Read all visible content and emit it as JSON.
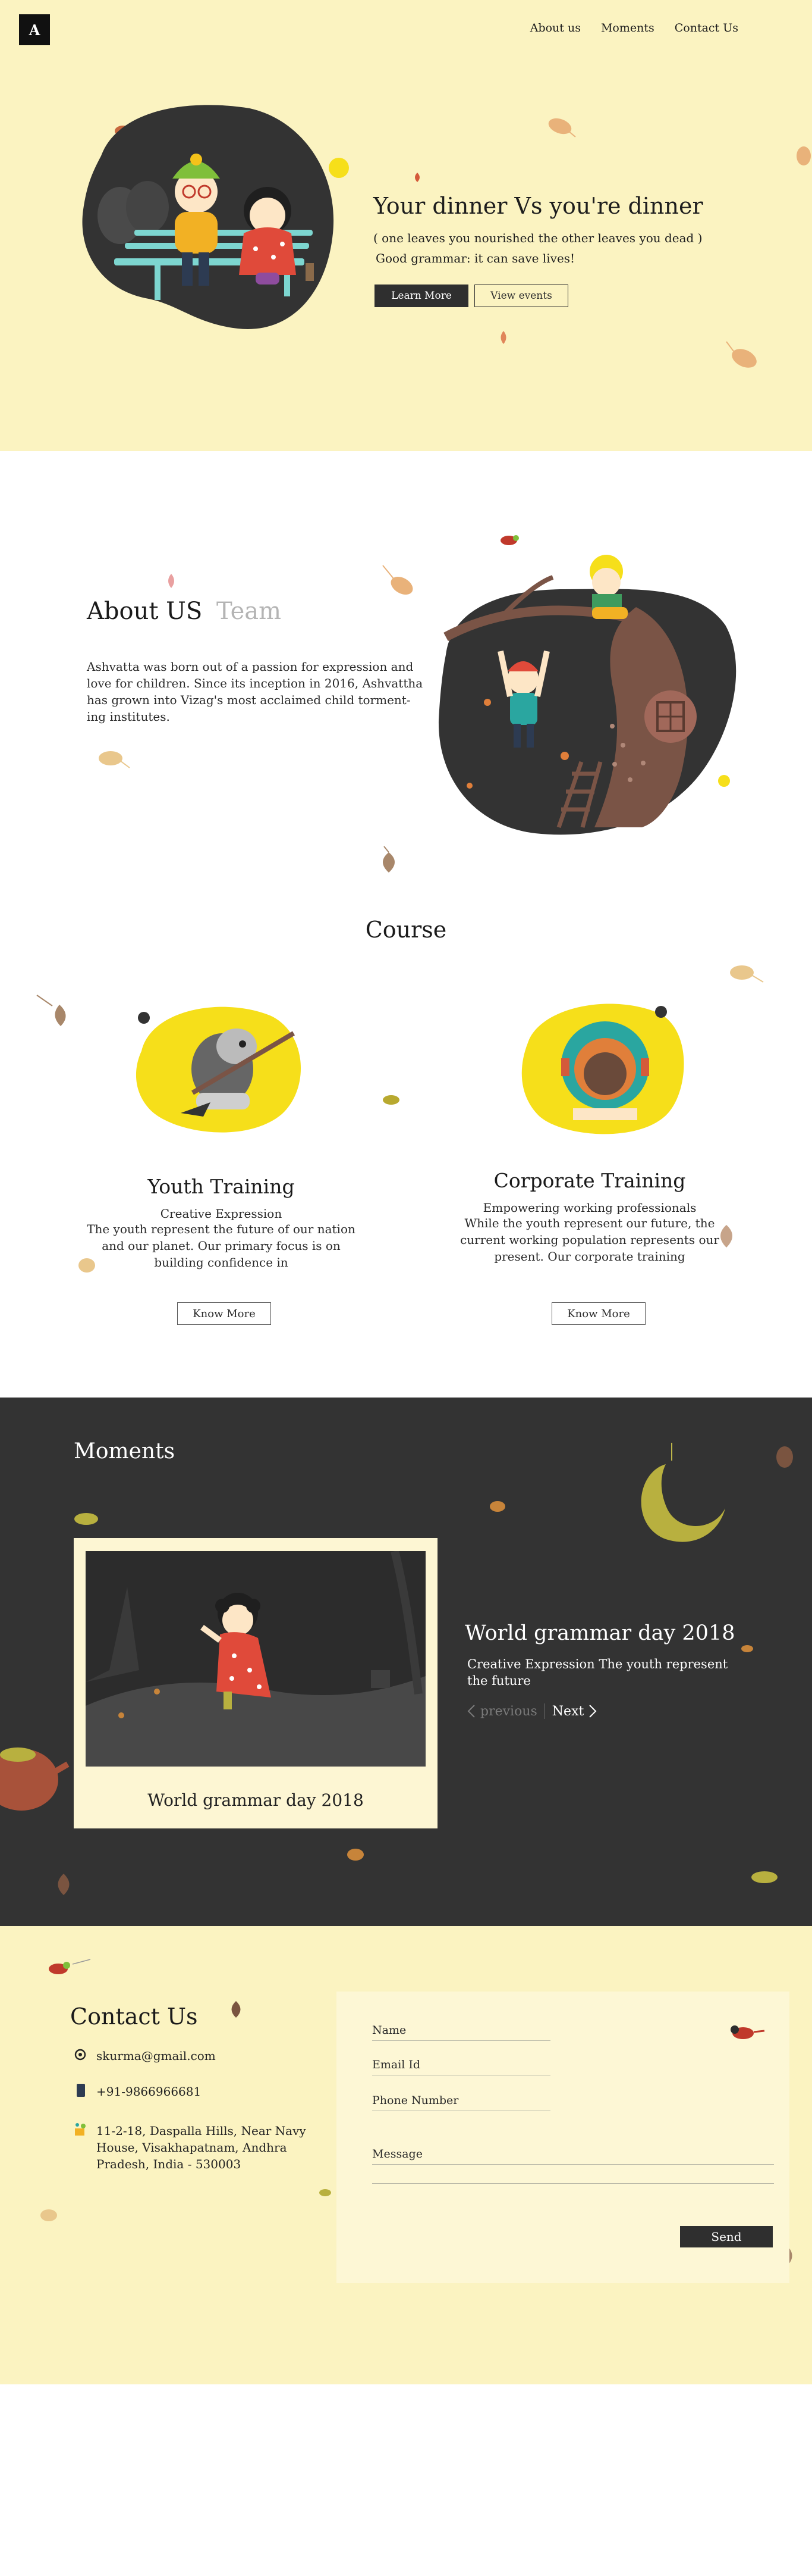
{
  "brand": {
    "logo_letter": "A"
  },
  "nav": {
    "items": [
      "About us",
      "Moments",
      "Contact Us"
    ]
  },
  "hero": {
    "title": "Your dinner Vs you're dinner",
    "sub1": "( one leaves you nourished the other leaves you dead )",
    "sub2": "Good grammar: it can save lives!",
    "btn_primary": "Learn More",
    "btn_secondary": "View events"
  },
  "about": {
    "heading": "About US",
    "team": "Team",
    "text": "Ashvatta was born out of a passion for expression and love for children. Since its inception in 2016, Ashvattha has grown into Vizag's most acclaimed child torment-ing institutes."
  },
  "course": {
    "title": "Course",
    "cards": [
      {
        "title": "Youth Training",
        "sub": "Creative Expression",
        "desc": "The youth represent the future of our nation and our planet. Our primary focus is on building confidence in",
        "button": "Know More"
      },
      {
        "title": "Corporate Training",
        "sub": "Empowering working professionals",
        "desc": "While the youth represent our future, the current working population represents our present. Our corporate training",
        "button": "Know More"
      }
    ]
  },
  "moments": {
    "title": "Moments",
    "caption": "World grammar day 2018",
    "headline": "World grammar day 2018",
    "desc": "Creative Expression The youth represent the future",
    "previous": "previous",
    "next": "Next"
  },
  "contact": {
    "title": "Contact Us",
    "email": "skurma@gmail.com",
    "phone": "+91-9866966681",
    "address": "11-2-18, Daspalla Hills, Near Navy House, Visakhapatnam, Andhra Pradesh, India - 530003",
    "form": {
      "name": "Name",
      "email": "Email Id",
      "phone": "Phone Number",
      "message": "Message",
      "send": "Send"
    }
  },
  "colors": {
    "cream": "#fbf3c1",
    "dark": "#333333",
    "yellow": "#f6df1a",
    "leaf": "#e9b27a"
  },
  "icons": [
    "at-icon",
    "phone-icon",
    "location-icon",
    "chevron-left-icon",
    "chevron-right-icon"
  ]
}
